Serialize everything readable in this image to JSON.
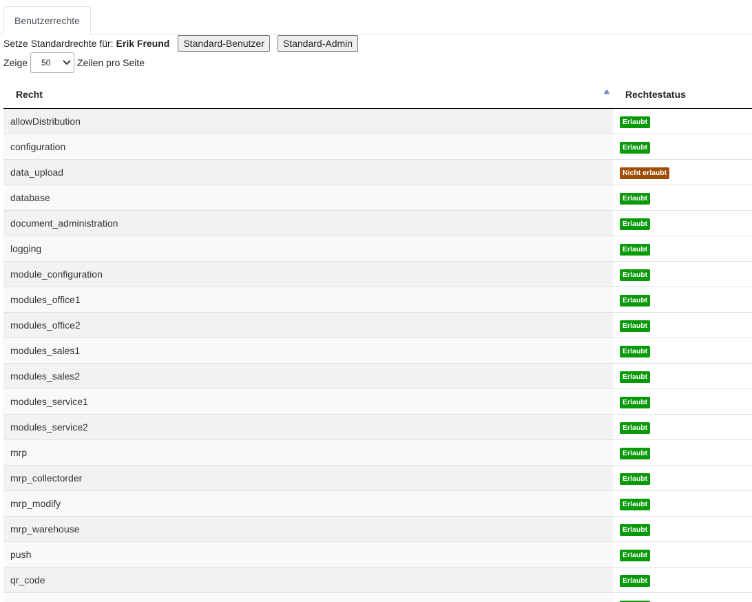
{
  "tabs": [
    {
      "label": "Benutzerrechte",
      "active": true
    }
  ],
  "defaults": {
    "prefix": "Setze Standardrechte für:",
    "user_name": "Erik Freund",
    "btn_standard_user": "Standard-Benutzer",
    "btn_standard_admin": "Standard-Admin"
  },
  "paging": {
    "show_label": "Zeige",
    "page_size": "50",
    "suffix_label": "Zeilen pro Seite"
  },
  "table": {
    "columns": [
      "Recht",
      "Rechtestatus"
    ],
    "sorted_column": "Recht",
    "sort_direction": "ascending",
    "status_colors": {
      "Erlaubt": "#089a08",
      "Nicht erlaubt": "#a04d06"
    },
    "rows": [
      {
        "right": "allowDistribution",
        "status": "Erlaubt"
      },
      {
        "right": "configuration",
        "status": "Erlaubt"
      },
      {
        "right": "data_upload",
        "status": "Nicht erlaubt"
      },
      {
        "right": "database",
        "status": "Erlaubt"
      },
      {
        "right": "document_administration",
        "status": "Erlaubt"
      },
      {
        "right": "logging",
        "status": "Erlaubt"
      },
      {
        "right": "module_configuration",
        "status": "Erlaubt"
      },
      {
        "right": "modules_office1",
        "status": "Erlaubt"
      },
      {
        "right": "modules_office2",
        "status": "Erlaubt"
      },
      {
        "right": "modules_sales1",
        "status": "Erlaubt"
      },
      {
        "right": "modules_sales2",
        "status": "Erlaubt"
      },
      {
        "right": "modules_service1",
        "status": "Erlaubt"
      },
      {
        "right": "modules_service2",
        "status": "Erlaubt"
      },
      {
        "right": "mrp",
        "status": "Erlaubt"
      },
      {
        "right": "mrp_collectorder",
        "status": "Erlaubt"
      },
      {
        "right": "mrp_modify",
        "status": "Erlaubt"
      },
      {
        "right": "mrp_warehouse",
        "status": "Erlaubt"
      },
      {
        "right": "push",
        "status": "Erlaubt"
      },
      {
        "right": "qr_code",
        "status": "Erlaubt"
      },
      {
        "right": "",
        "status": "Erlaubt"
      }
    ]
  }
}
